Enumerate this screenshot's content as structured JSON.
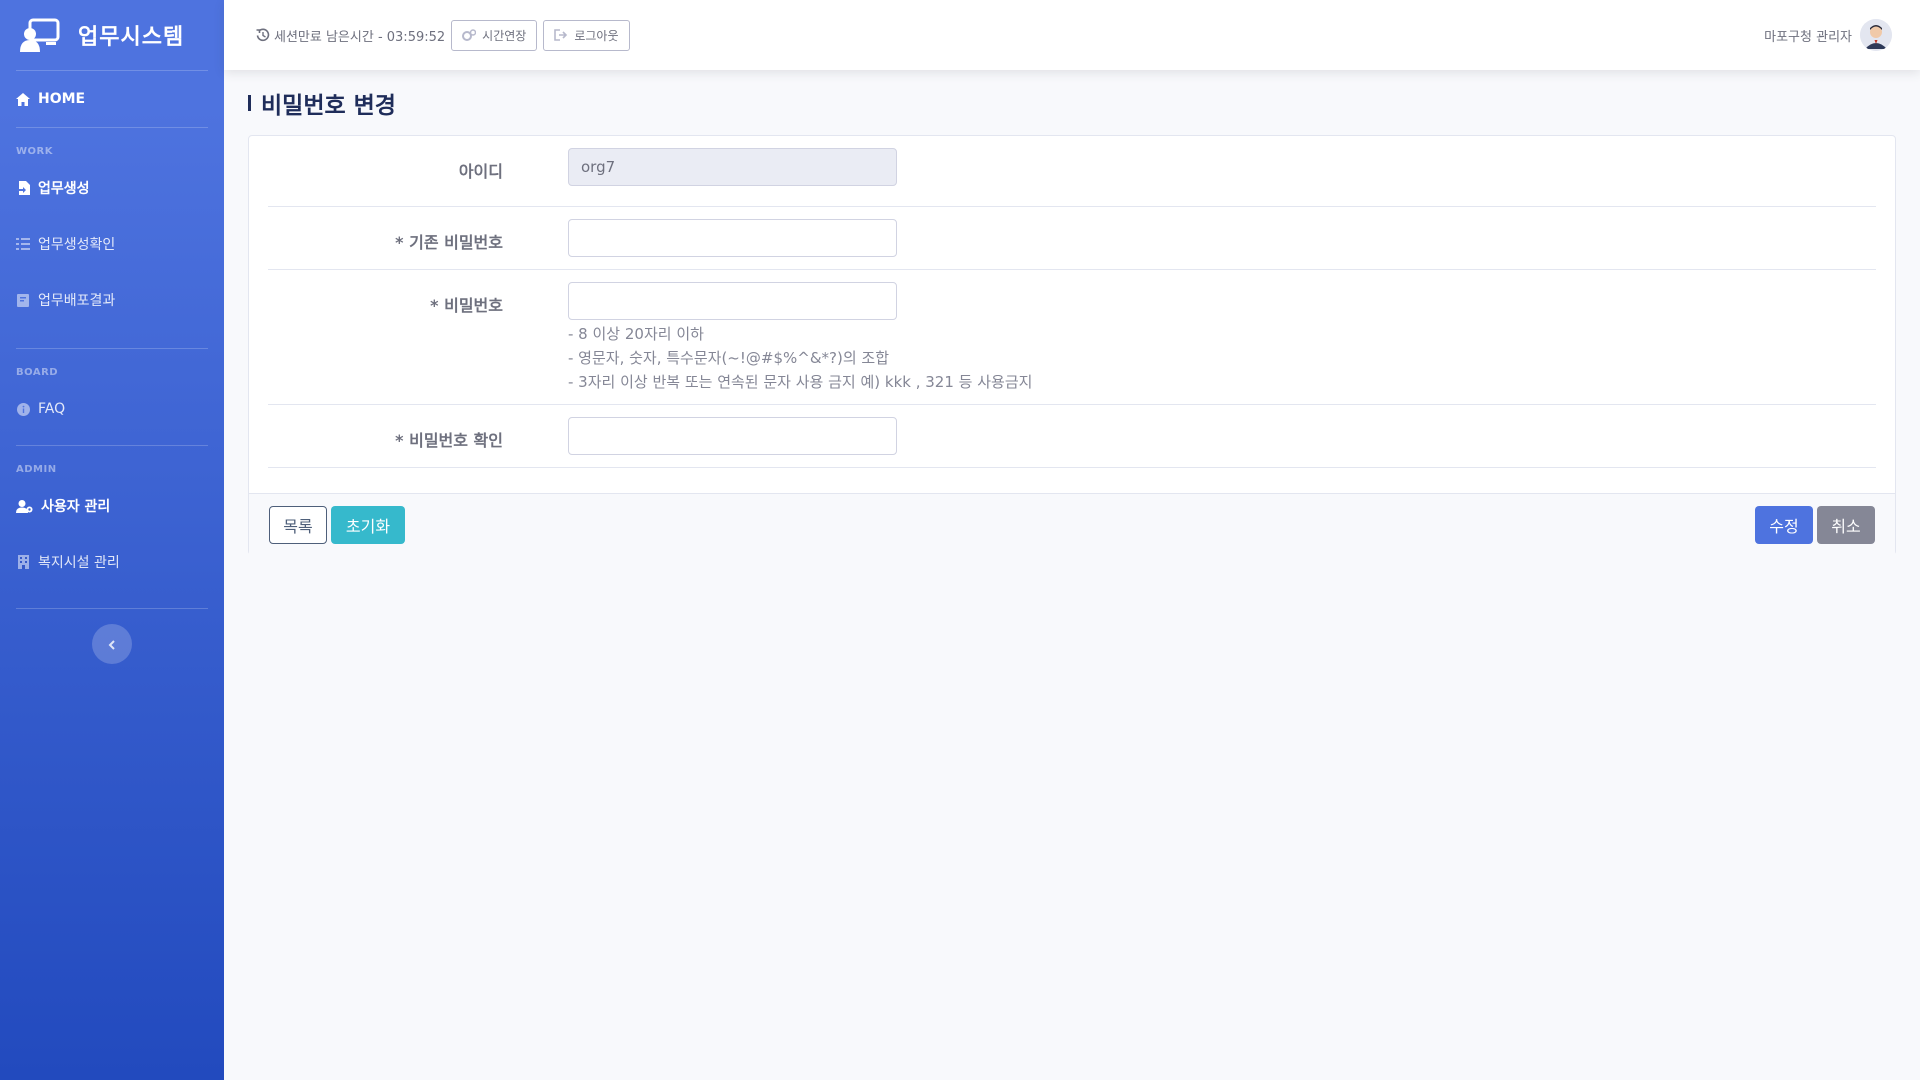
{
  "sidebar": {
    "brand": "업무시스템",
    "home": "HOME",
    "sections": {
      "work": "WORK",
      "board": "BOARD",
      "admin": "ADMIN"
    },
    "items": {
      "job_create": "업무생성",
      "job_check": "업무생성확인",
      "job_result": "업무배포결과",
      "faq": "FAQ",
      "user_admin": "사용자 관리",
      "facility_admin": "복지시설 관리"
    }
  },
  "topbar": {
    "session_text": "세션만료 남은시간 - 03:59:52",
    "extend_label": "시간연장",
    "logout_label": "로그아웃",
    "user_name": "마포구청 관리자"
  },
  "page": {
    "title": "비밀번호 변경"
  },
  "form": {
    "id_label": "아이디",
    "id_value": "org7",
    "current_pw_label": "* 기존 비밀번호",
    "new_pw_label": "* 비밀번호",
    "confirm_pw_label": "* 비밀번호 확인",
    "hints": [
      "- 8 이상 20자리 이하",
      "- 영문자, 숫자, 특수문자(~!@#$%^&*?)의 조합",
      "- 3자리 이상 반복 또는 연속된 문자 사용 금지 예) kkk , 321 등 사용금지"
    ]
  },
  "buttons": {
    "list": "목록",
    "reset": "초기화",
    "save": "수정",
    "cancel": "취소"
  },
  "colors": {
    "primary": "#4e73df",
    "info": "#36b9cc",
    "secondary": "#858796"
  }
}
